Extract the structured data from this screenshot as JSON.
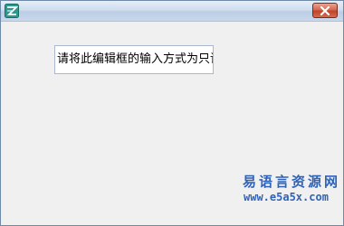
{
  "window": {
    "icon": "app-logo-icon",
    "close_icon": "close-x-icon"
  },
  "edit_box": {
    "value": "请将此编辑框的输入方式为只读"
  },
  "watermark": {
    "site_name": "易语言资源网",
    "url": "www.e5a5x.com"
  },
  "colors": {
    "close_button": "#c0432a",
    "watermark": "#2f63b8",
    "titlebar": "#cfddef"
  }
}
